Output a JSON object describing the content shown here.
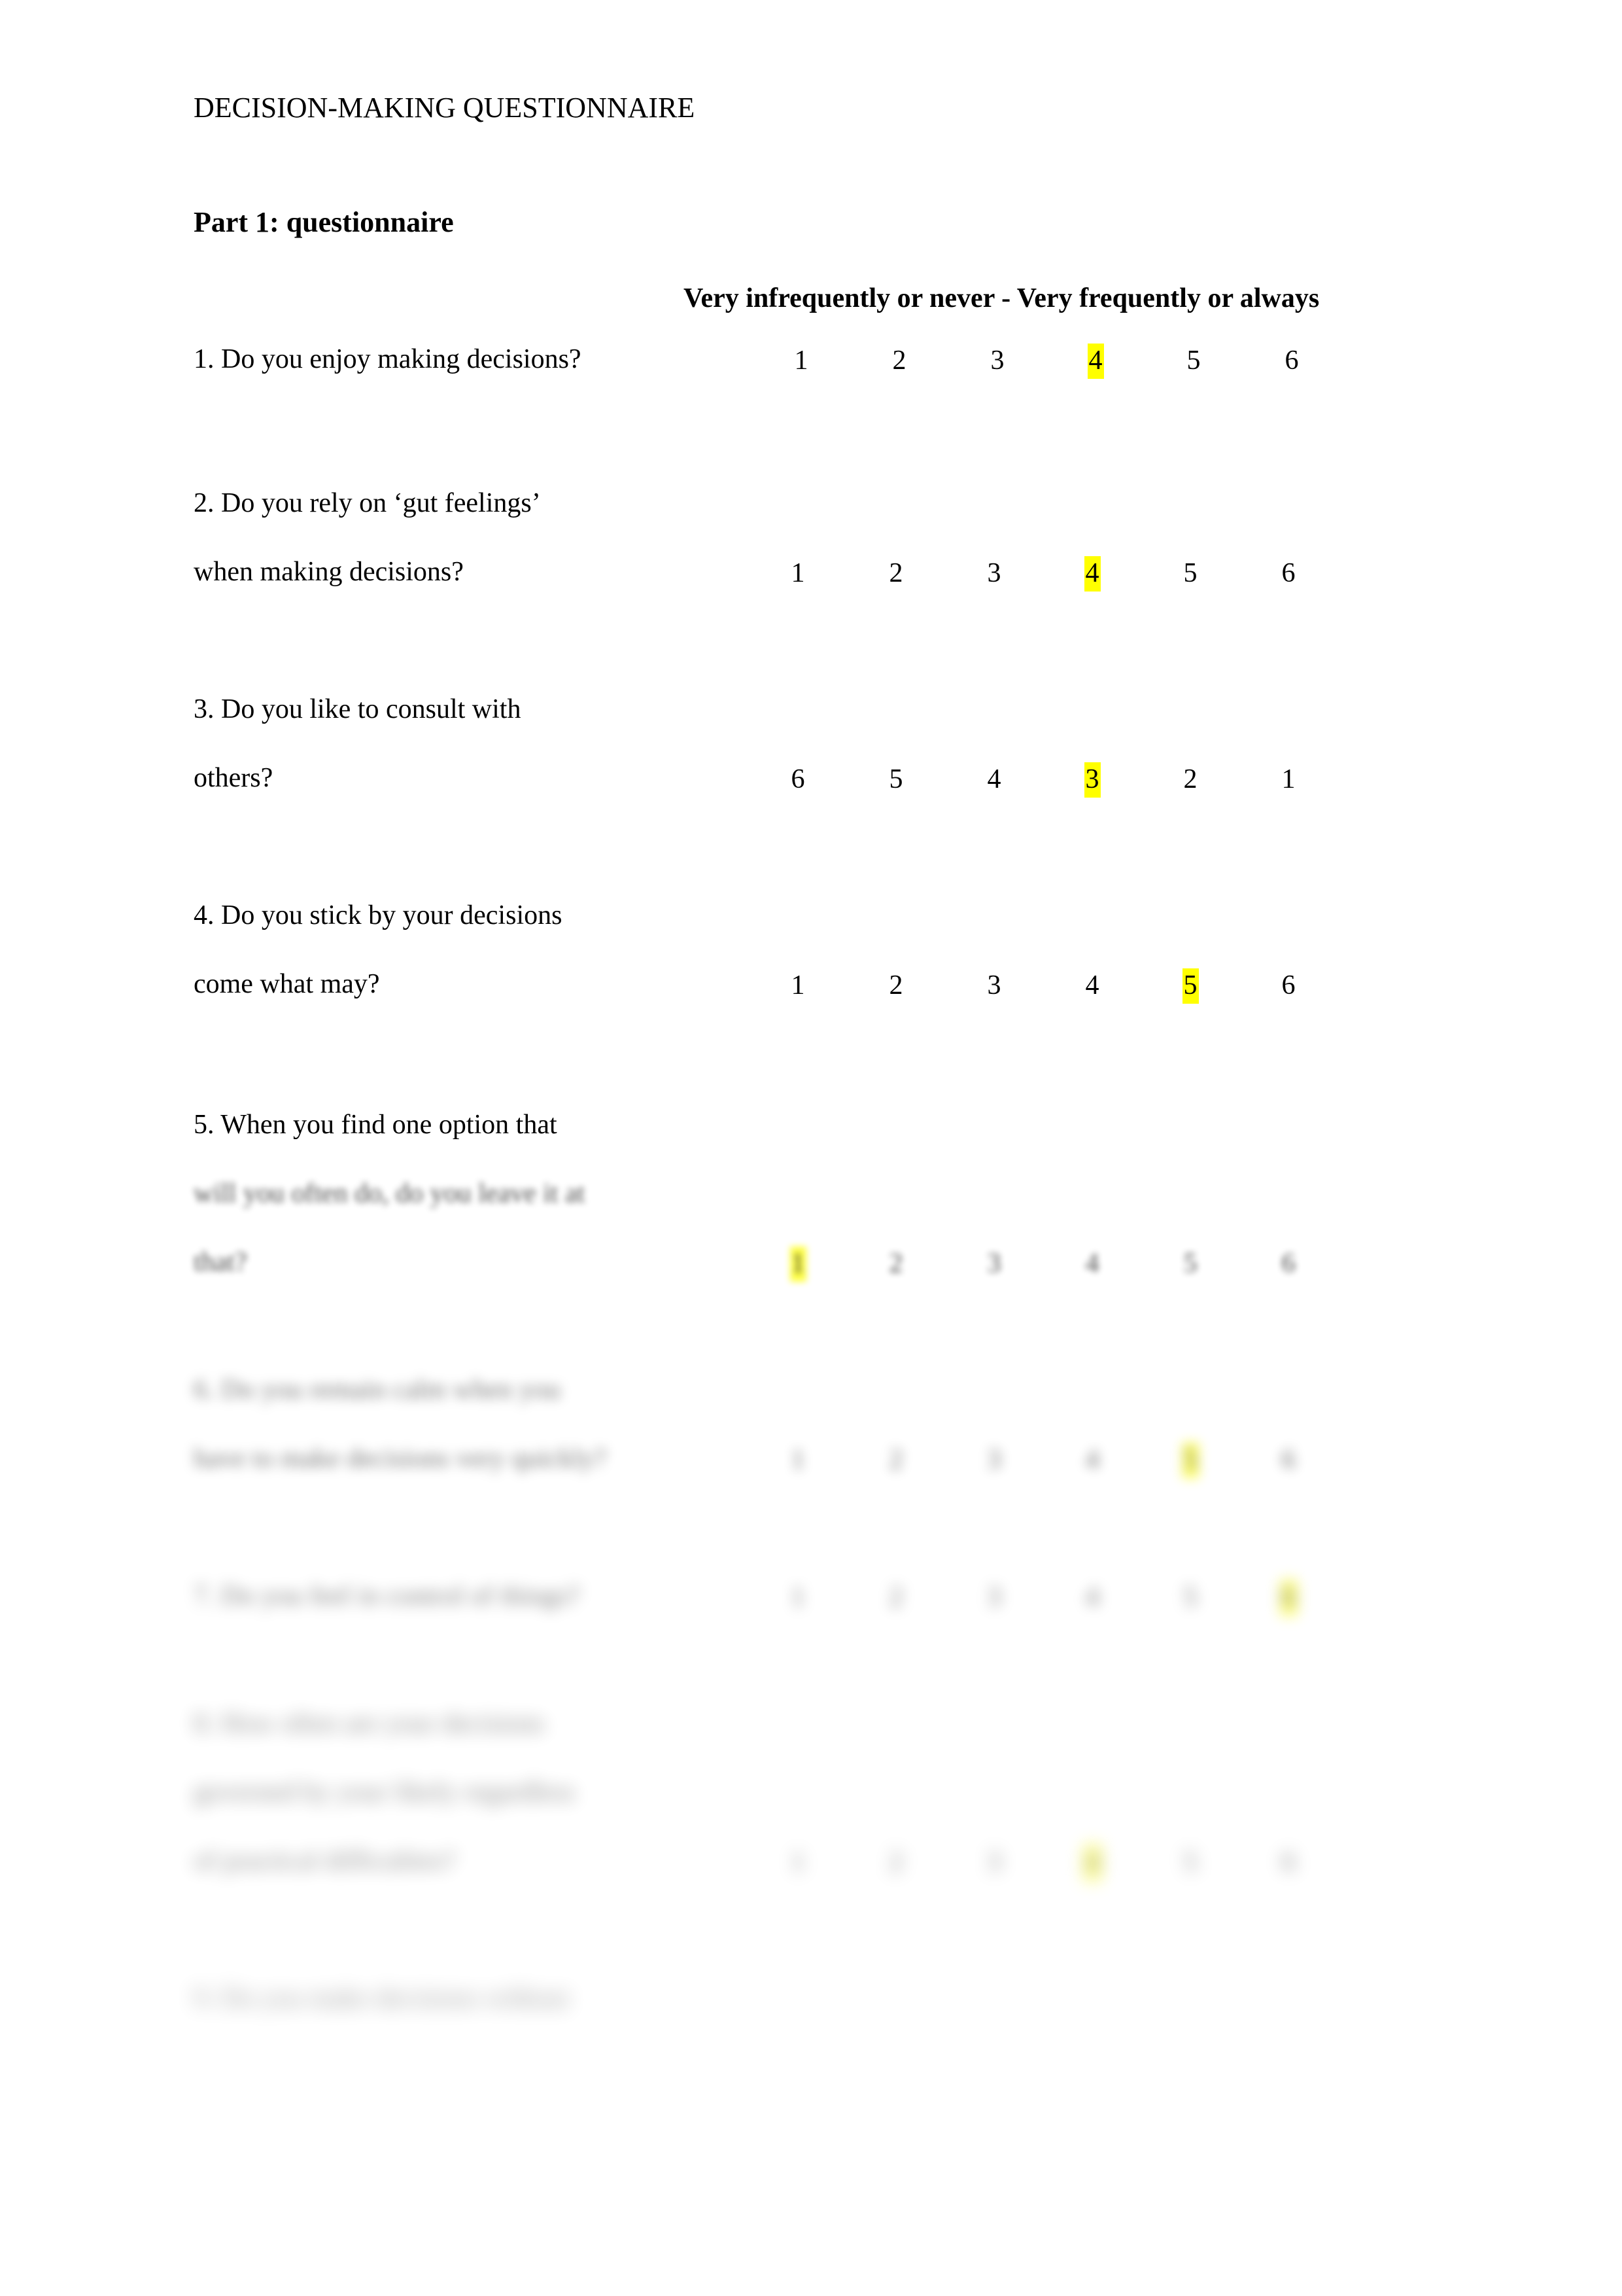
{
  "document": {
    "header": "DECISION-MAKING QUESTIONNAIRE",
    "part_title": "Part 1: questionnaire",
    "scale_header": "Very infrequently or never - Very frequently or always",
    "highlight_color": "#FFFF00",
    "page_background": "#FFFFFF",
    "text_color": "#000000"
  },
  "questions": [
    {
      "id": "q1",
      "lines": [
        "1. Do you enjoy making decisions?"
      ],
      "scale": [
        "1",
        "2",
        "3",
        "4",
        "5",
        "6"
      ],
      "selected_index": 3,
      "selected_value": "4",
      "legible": true,
      "blur_level": 0
    },
    {
      "id": "q2",
      "lines": [
        "2. Do you rely on ‘gut feelings’",
        "when making decisions?"
      ],
      "scale": [
        "1",
        "2",
        "3",
        "4",
        "5",
        "6"
      ],
      "selected_index": 3,
      "selected_value": "4",
      "legible": true,
      "blur_level": 0
    },
    {
      "id": "q3",
      "lines": [
        "3. Do you like to consult with",
        "others?"
      ],
      "scale": [
        "6",
        "5",
        "4",
        "3",
        "2",
        "1"
      ],
      "selected_index": 3,
      "selected_value": "3",
      "legible": true,
      "blur_level": 0
    },
    {
      "id": "q4",
      "lines": [
        "4. Do you stick by your decisions",
        "come what may?"
      ],
      "scale": [
        "1",
        "2",
        "3",
        "4",
        "5",
        "6"
      ],
      "selected_index": 4,
      "selected_value": "5",
      "legible": true,
      "blur_level": 0
    },
    {
      "id": "q5",
      "lines": [
        "5. When you find one option that",
        "",
        ""
      ],
      "scale": [
        "",
        "",
        "",
        "",
        "",
        ""
      ],
      "selected_index": 0,
      "selected_value": "",
      "legible": false,
      "blur_level": 3
    },
    {
      "id": "q6",
      "lines": [
        "",
        ""
      ],
      "scale": [
        "",
        "",
        "",
        "",
        "",
        ""
      ],
      "selected_index": 4,
      "selected_value": "",
      "legible": false,
      "blur_level": 5
    },
    {
      "id": "q7",
      "lines": [
        ""
      ],
      "scale": [
        "",
        "",
        "",
        "",
        "",
        ""
      ],
      "selected_index": 5,
      "selected_value": "",
      "legible": false,
      "blur_level": 6
    },
    {
      "id": "q8",
      "lines": [
        "",
        "",
        ""
      ],
      "scale": [
        "",
        "",
        "",
        "",
        "",
        ""
      ],
      "selected_index": 3,
      "selected_value": "",
      "legible": false,
      "blur_level": 7
    },
    {
      "id": "q9",
      "lines": [
        ""
      ],
      "scale": [],
      "selected_index": -1,
      "selected_value": "",
      "legible": false,
      "blur_level": 8
    }
  ],
  "layout": {
    "scale_column_x": [
      1190,
      1340,
      1490,
      1640,
      1790,
      1940
    ],
    "left_margin": 296,
    "question_tops": {
      "q1": 525,
      "q2_l1": 745,
      "q2_l2": 850,
      "q3_l1": 1060,
      "q3_l2": 1165,
      "q4_l1": 1375,
      "q4_l2": 1480,
      "q5_l1": 1695,
      "q5_l2": 1800,
      "q5_l3": 1905,
      "q6_l1": 2100,
      "q6_l2": 2205,
      "q7_l1": 2415,
      "q8_l1": 2610,
      "q8_l2": 2715,
      "q8_l3": 2820,
      "q9_l1": 3030
    },
    "blurred_line_widths": {
      "q5_l2": 640,
      "q5_l3": 90,
      "q6_l1": 560,
      "q6_l2": 700,
      "q7_l1": 585,
      "q8_l1": 545,
      "q8_l2": 620,
      "q8_l3": 440,
      "q9_l1": 620
    }
  }
}
